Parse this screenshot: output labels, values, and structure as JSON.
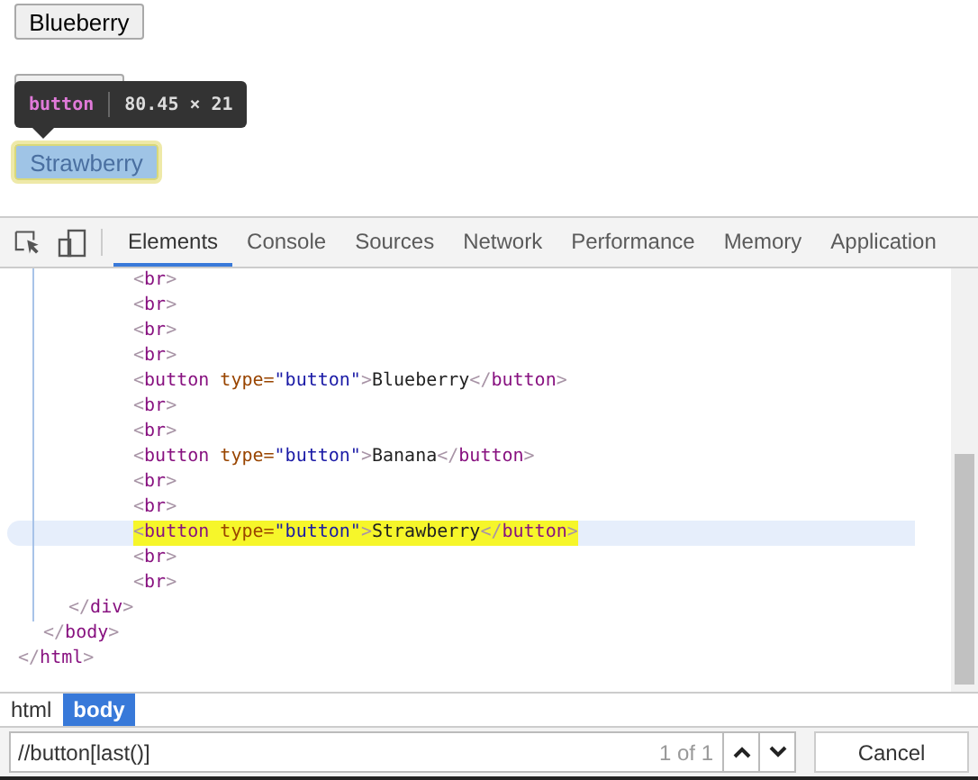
{
  "page": {
    "buttons": [
      {
        "kind": "labeled",
        "label": "Blueberry",
        "inspected": false
      },
      {
        "kind": "covered",
        "inspected": false
      },
      {
        "kind": "labeled",
        "label": "Strawberry",
        "inspected": true
      }
    ],
    "tooltip": {
      "tag": "button",
      "size": "80.45 × 21"
    }
  },
  "devtools": {
    "tabs": [
      {
        "label": "Elements",
        "selected": true
      },
      {
        "label": "Console",
        "selected": false
      },
      {
        "label": "Sources",
        "selected": false
      },
      {
        "label": "Network",
        "selected": false
      },
      {
        "label": "Performance",
        "selected": false
      },
      {
        "label": "Memory",
        "selected": false
      },
      {
        "label": "Application",
        "selected": false
      }
    ],
    "tree": [
      {
        "close": "</html>",
        "children": [
          {
            "close": "</body>",
            "children": [
              {
                "close": "</div>",
                "children": [
                  {
                    "text": "<br>",
                    "selected": false
                  },
                  {
                    "text": "<br>",
                    "selected": false
                  },
                  {
                    "text": "<br>",
                    "selected": false
                  },
                  {
                    "text": "<br>",
                    "selected": false
                  },
                  {
                    "text": "<button type=\"button\">Blueberry</button>",
                    "selected": false
                  },
                  {
                    "text": "<br>",
                    "selected": false
                  },
                  {
                    "text": "<br>",
                    "selected": false
                  },
                  {
                    "text": "<button type=\"button\">Banana</button>",
                    "selected": false
                  },
                  {
                    "text": "<br>",
                    "selected": false
                  },
                  {
                    "text": "<br>",
                    "selected": false
                  },
                  {
                    "text": "<button type=\"button\">Strawberry</button>",
                    "selected": true
                  },
                  {
                    "text": "<br>",
                    "selected": false
                  },
                  {
                    "text": "<br>",
                    "selected": false
                  }
                ]
              }
            ]
          }
        ]
      }
    ],
    "breadcrumbs": [
      {
        "label": "html",
        "selected": false
      },
      {
        "label": "body",
        "selected": true
      }
    ],
    "search": {
      "value": "//button[last()]",
      "count": "1 of 1",
      "cancel": "Cancel"
    }
  }
}
